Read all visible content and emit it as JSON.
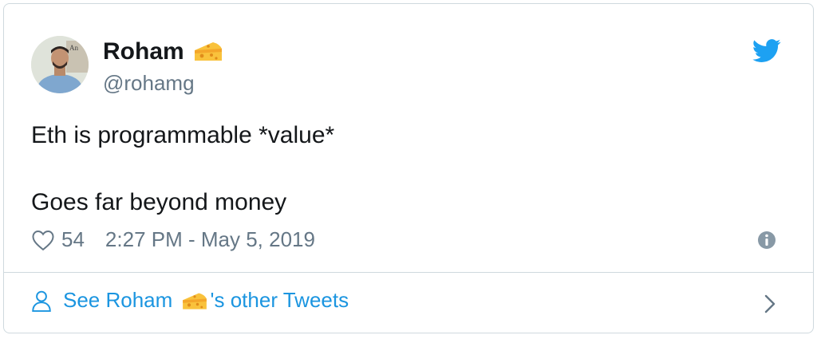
{
  "author": {
    "name": "Roham",
    "handle": "@rohamg",
    "name_emoji": "cheese-emoji"
  },
  "tweet": {
    "line1": "Eth is programmable *value*",
    "line2": "Goes far beyond money"
  },
  "meta": {
    "likes": "54",
    "timestamp": "2:27 PM - May 5, 2019"
  },
  "footer": {
    "prefix": "See Roham ",
    "suffix": "'s other Tweets"
  },
  "colors": {
    "twitter_blue": "#1da1f2",
    "link_blue": "#1b95e0",
    "muted": "#657786"
  }
}
